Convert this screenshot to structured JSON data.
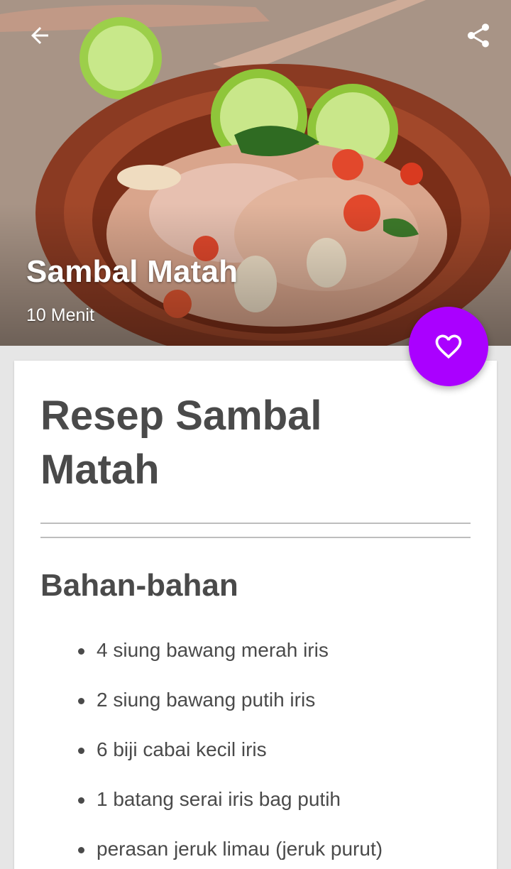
{
  "app": {
    "accent_color": "#aa00ff",
    "icons": {
      "back": "arrow-left-icon",
      "share": "share-icon",
      "favorite": "heart-outline-icon"
    }
  },
  "hero": {
    "title": "Sambal Matah",
    "subtitle": "10 Menit"
  },
  "recipe": {
    "title": "Resep Sambal Matah",
    "section_title": "Bahan-bahan",
    "ingredients": [
      "4 siung bawang merah iris",
      "2 siung bawang putih iris",
      "6 biji cabai kecil iris",
      "1 batang serai iris bag putih",
      "perasan jeruk limau (jeruk purut)"
    ]
  }
}
